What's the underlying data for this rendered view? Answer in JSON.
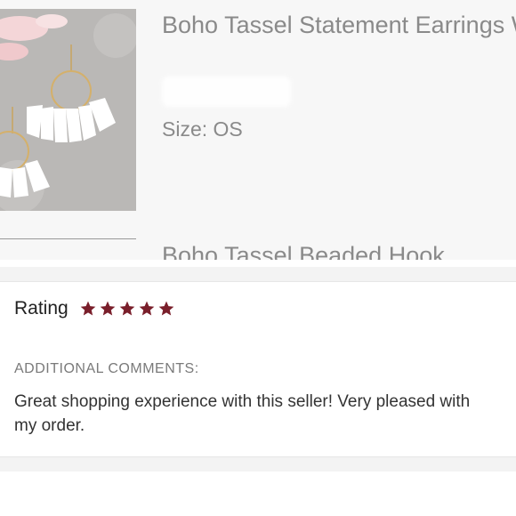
{
  "listing": {
    "title": "Boho Tassel Statement Earrings White Festival",
    "size_text": "Size: OS",
    "next_item_title": "Boho Tassel Beaded Hook"
  },
  "review": {
    "rating_label": "Rating",
    "stars": 5,
    "star_color": "#7a1f2b",
    "comments_heading": "ADDITIONAL COMMENTS:",
    "comment": "Great shopping experience with this seller! Very pleased with my order."
  }
}
